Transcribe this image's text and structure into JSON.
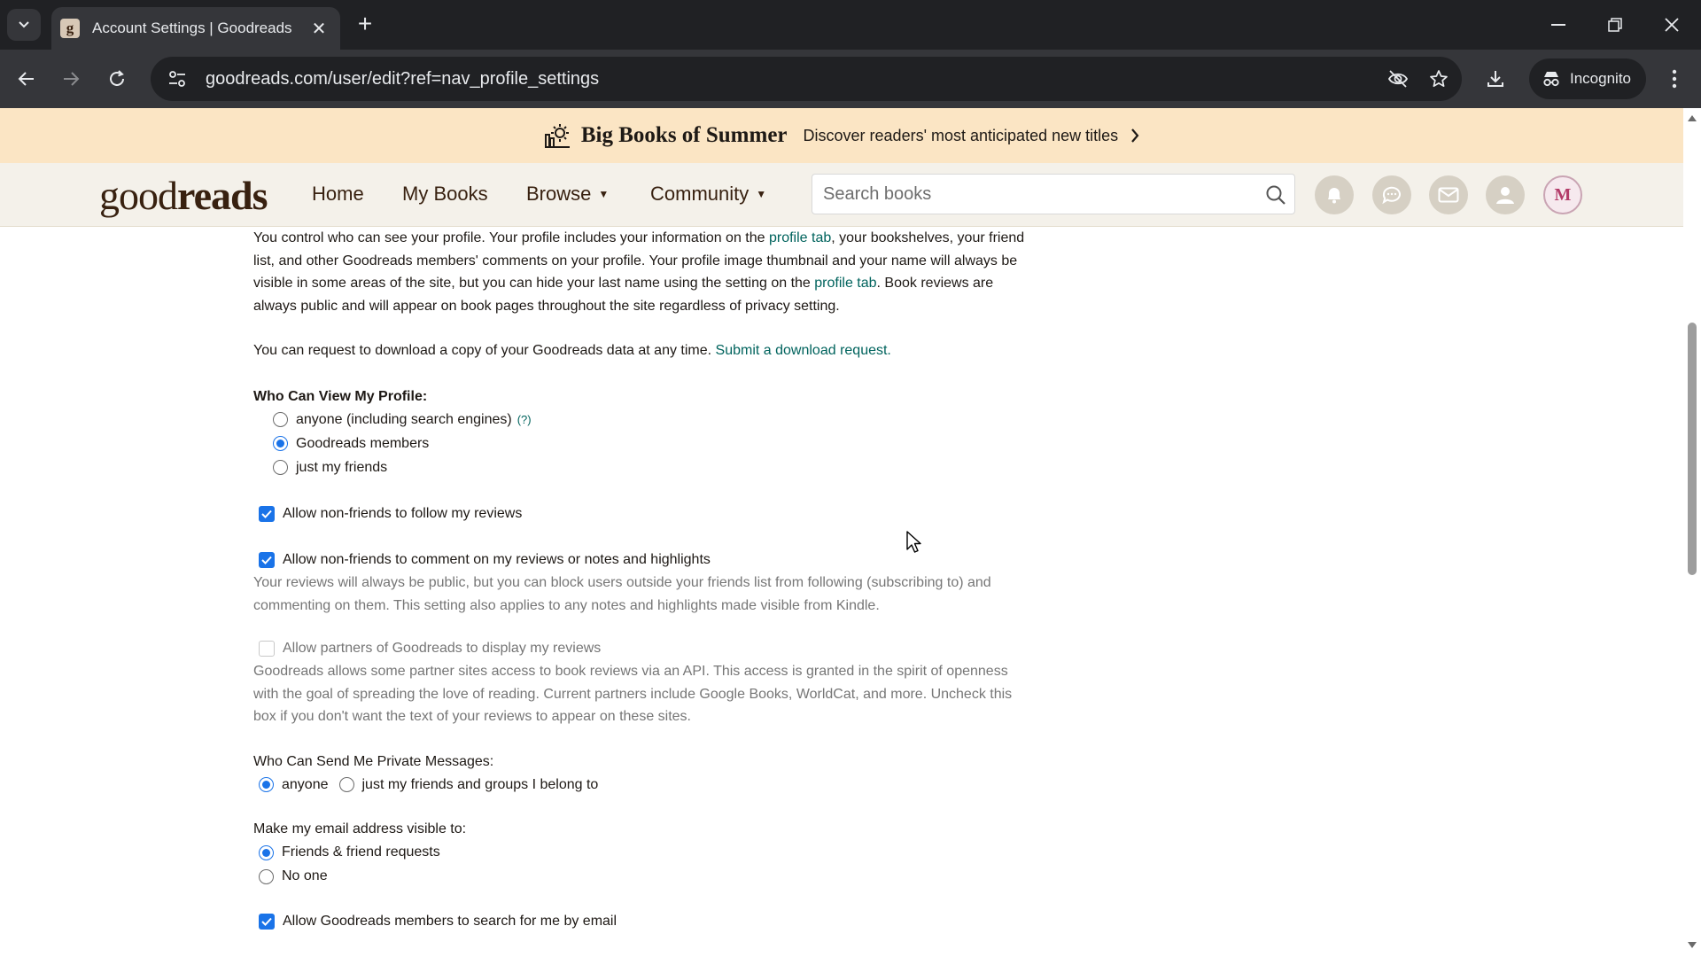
{
  "browser": {
    "tab_title": "Account Settings | Goodreads",
    "url": "goodreads.com/user/edit?ref=nav_profile_settings",
    "incognito_label": "Incognito",
    "favicon_letter": "g"
  },
  "promo": {
    "title": "Big Books of Summer",
    "subtitle": "Discover readers' most anticipated new titles"
  },
  "header": {
    "logo_light": "good",
    "logo_bold": "reads",
    "nav": {
      "home": "Home",
      "my_books": "My Books",
      "browse": "Browse",
      "community": "Community"
    },
    "search_placeholder": "Search books",
    "avatar_initial": "M"
  },
  "content": {
    "intro": {
      "part1": "You control who can see your profile. Your profile includes your information on the ",
      "link1": "profile tab",
      "part2": ", your bookshelves, your friend list, and other Goodreads members' comments on your profile. Your profile image thumbnail and your name will always be visible in some areas of the site, but you can hide your last name using the setting on the ",
      "link2": "profile tab",
      "part3": ". Book reviews are always public and will appear on book pages throughout the site regardless of privacy setting."
    },
    "download": {
      "text": "You can request to download a copy of your Goodreads data at any time. ",
      "link": "Submit a download request."
    },
    "view_profile": {
      "label": "Who Can View My Profile:",
      "help": "(?)",
      "options": [
        "anyone (including search engines)",
        "Goodreads members",
        "just my friends"
      ]
    },
    "follow_reviews": "Allow non-friends to follow my reviews",
    "comment_reviews": {
      "label": "Allow non-friends to comment on my reviews or notes and highlights",
      "note": "Your reviews will always be public, but you can block users outside your friends list from following (subscribing to) and commenting on them. This setting also applies to any notes and highlights made visible from Kindle."
    },
    "partners": {
      "label": "Allow partners of Goodreads to display my reviews",
      "note": "Goodreads allows some partner sites access to book reviews via an API. This access is granted in the spirit of openness with the goal of spreading the love of reading. Current partners include Google Books, WorldCat, and more. Uncheck this box if you don't want the text of your reviews to appear on these sites."
    },
    "messages": {
      "label": "Who Can Send Me Private Messages:",
      "options": [
        "anyone",
        "just my friends and groups I belong to"
      ]
    },
    "email_visible": {
      "label": "Make my email address visible to:",
      "options": [
        "Friends & friend requests",
        "No one"
      ]
    },
    "search_by_email": "Allow Goodreads members to search for me by email"
  },
  "colors": {
    "link": "#00635d",
    "accent": "#1a73e8",
    "header_bg": "#f4f1ea",
    "promo_bg": "#fbe5c4"
  },
  "icons": [
    "search-icon",
    "notifications-icon",
    "friends-icon",
    "messages-icon",
    "profile-icon",
    "back-icon",
    "forward-icon",
    "reload-icon",
    "star-icon",
    "download-icon",
    "eye-off-icon",
    "incognito-icon",
    "close-icon"
  ]
}
